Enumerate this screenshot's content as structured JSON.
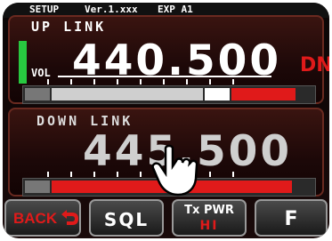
{
  "status": {
    "mode": "SETUP",
    "version": "Ver.1.xxx",
    "exp": "EXP A1"
  },
  "uplink": {
    "label": "UP LINK",
    "freq": "440.500",
    "vol_label": "VOL",
    "shift": "DN"
  },
  "downlink": {
    "label": "DOWN LINK",
    "freq": "445.500"
  },
  "buttons": {
    "back": "BACK",
    "sql": "SQL",
    "txpwr_top": "Tx PWR",
    "txpwr_bottom": "HI",
    "f": "F"
  },
  "colors": {
    "accent_red": "#e01a1a",
    "vol_green": "#28c840"
  }
}
